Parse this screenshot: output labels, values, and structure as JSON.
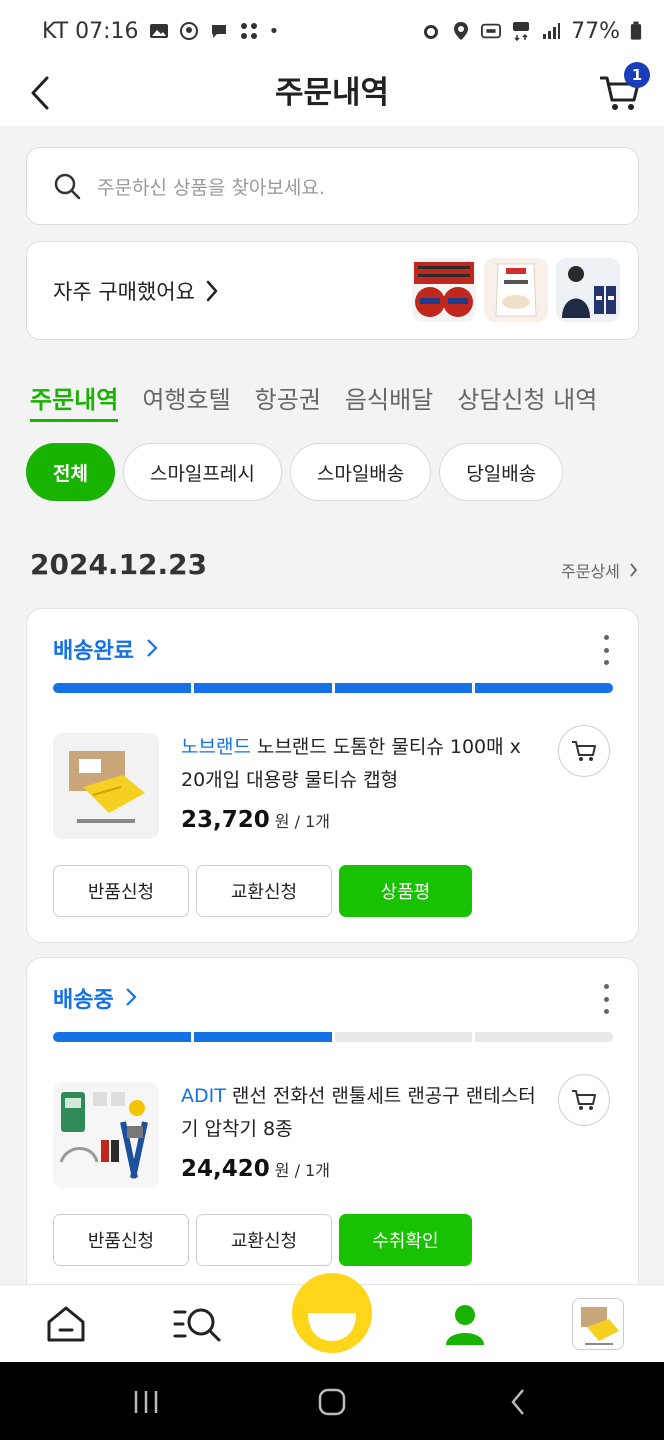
{
  "status_bar": {
    "carrier_time": "KT 07:16",
    "battery": "77%"
  },
  "header": {
    "title": "주문내역",
    "cart_count": "1"
  },
  "search": {
    "placeholder": "주문하신 상품을 찾아보세요."
  },
  "frequent": {
    "label": "자주 구매했어요"
  },
  "tabs": [
    {
      "label": "주문내역",
      "active": true
    },
    {
      "label": "여행호텔"
    },
    {
      "label": "항공권"
    },
    {
      "label": "음식배달"
    },
    {
      "label": "상담신청 내역"
    }
  ],
  "chips": [
    {
      "label": "전체",
      "active": true
    },
    {
      "label": "스마일프레시"
    },
    {
      "label": "스마일배송"
    },
    {
      "label": "당일배송"
    }
  ],
  "order": {
    "date": "2024.12.23",
    "detail_link": "주문상세"
  },
  "items": [
    {
      "status": "배송완료",
      "progress_steps_done": 4,
      "progress_steps_total": 4,
      "brand": "노브랜드",
      "title": " 노브랜드 도톰한 물티슈 100매 x 20개입 대용량 물티슈 캡형",
      "price": "23,720",
      "unit": "원 / 1개",
      "buttons": [
        "반품신청",
        "교환신청",
        "상품평"
      ]
    },
    {
      "status": "배송중",
      "progress_steps_done": 2,
      "progress_steps_total": 4,
      "brand": "ADIT",
      "title": " 랜선 전화선 랜툴세트 랜공구 랜테스터기 압착기 8종",
      "price": "24,420",
      "unit": "원 / 1개",
      "buttons": [
        "반품신청",
        "교환신청",
        "수취확인"
      ]
    }
  ],
  "colors": {
    "accent_green": "#18b200",
    "status_blue": "#1471e6",
    "badge_blue": "#1a3db8",
    "smile_yellow": "#ffd51a"
  }
}
